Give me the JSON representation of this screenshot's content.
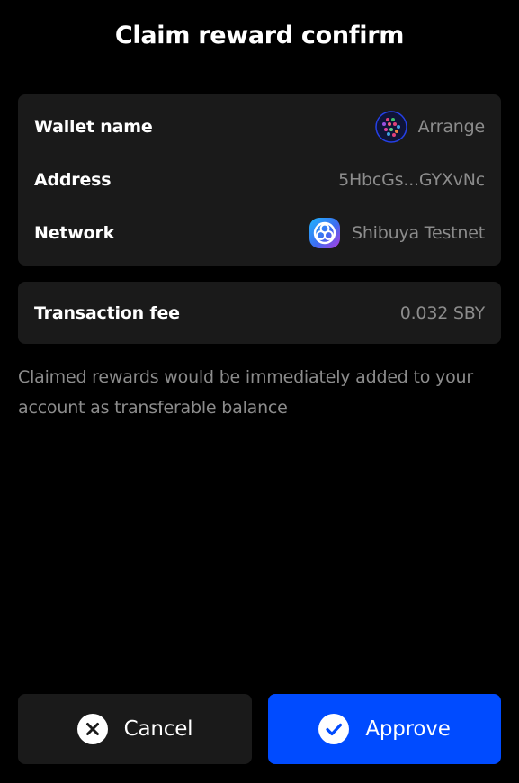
{
  "header": {
    "title": "Claim reward confirm"
  },
  "details": {
    "wallet_name_label": "Wallet name",
    "wallet_name_value": "Arrange",
    "wallet_icon": "wallet-avatar-icon",
    "address_label": "Address",
    "address_value": "5HbcGs...GYXvNc",
    "network_label": "Network",
    "network_value": "Shibuya Testnet",
    "network_icon": "shibuya-network-icon"
  },
  "fee": {
    "label": "Transaction fee",
    "value": "0.032 SBY"
  },
  "note": "Claimed rewards would be immediately added to your account as transferable balance",
  "actions": {
    "cancel_label": "Cancel",
    "cancel_icon": "close-circle-icon",
    "approve_label": "Approve",
    "approve_icon": "check-circle-icon"
  },
  "colors": {
    "background": "#000000",
    "card": "#1a1a1a",
    "primary": "#004bff",
    "muted_text": "#8c8c8c"
  }
}
